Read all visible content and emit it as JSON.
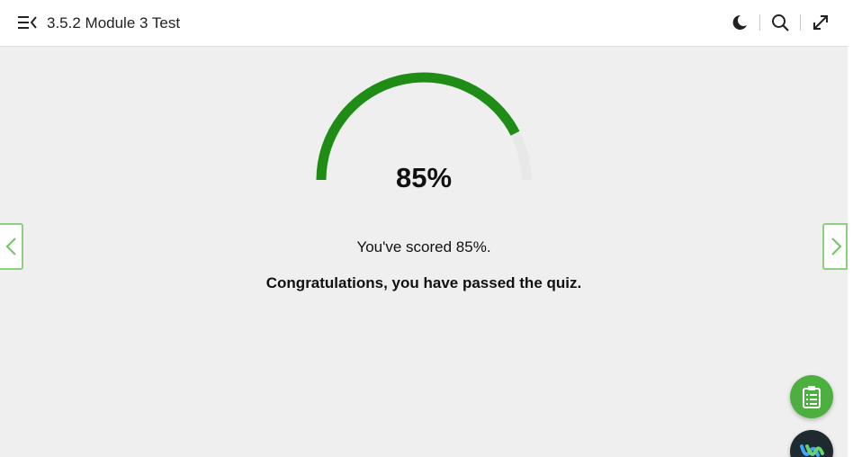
{
  "header": {
    "title": "3.5.2 Module 3 Test",
    "icons": [
      "menu-collapse-icon",
      "moon-icon",
      "search-icon",
      "fullscreen-icon"
    ]
  },
  "result": {
    "score_percent": 85,
    "score_display": "85%",
    "score_message": "You've scored 85%.",
    "pass_message": "Congratulations, you have passed the quiz."
  },
  "colors": {
    "gauge_fill": "#1e8c15",
    "gauge_track": "#e8e8e8",
    "nav_border": "#8ccf7e",
    "fab_green": "#4caf3f"
  },
  "nav": {
    "prev_icon": "chevron-left-icon",
    "next_icon": "chevron-right-icon"
  },
  "fabs": [
    "clipboard-list-icon",
    "webex-icon"
  ]
}
